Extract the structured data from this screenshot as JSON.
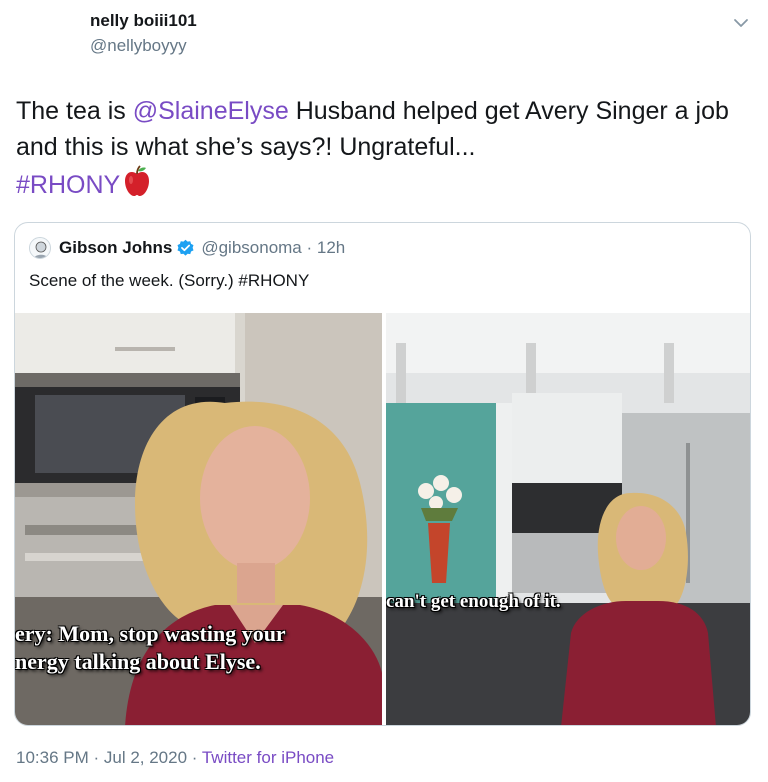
{
  "tweet": {
    "display_name": "nelly boiii101",
    "handle": "@nellyboyyy",
    "text_part1": "The tea is ",
    "mention": "@SlaineElyse",
    "text_part2": " Husband helped get Avery Singer a job and this is what she’s says?! Ungrateful...",
    "hashtag": "#RHONY",
    "emoji": "red-apple-icon",
    "timestamp": "10:36 PM · Jul 2, 2020 · ",
    "source": "Twitter for iPhone"
  },
  "quoted_tweet": {
    "display_name": "Gibson Johns",
    "handle_time": "@gibsonoma · 12h",
    "text": "Scene of the week. (Sorry.) #RHONY",
    "images": [
      {
        "subtitle_lines": [
          "ery: Mom, stop wasting your",
          "nergy talking about Elyse."
        ]
      },
      {
        "subtitle_lines": [
          "can't get enough of it."
        ]
      }
    ]
  },
  "colors": {
    "link": "#794bc4",
    "secondary_text": "#657786",
    "verified": "#1da1f2",
    "border": "#ccd6dd"
  },
  "icons": [
    "chevron-down-icon",
    "verified-badge-icon",
    "red-apple-icon"
  ]
}
